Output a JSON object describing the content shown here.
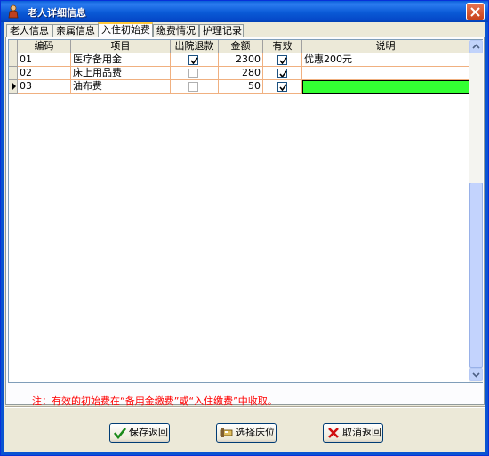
{
  "window": {
    "title": "老人详细信息"
  },
  "tabs": [
    {
      "label": "老人信息",
      "active": false
    },
    {
      "label": "亲属信息",
      "active": false
    },
    {
      "label": "入住初始费",
      "active": true
    },
    {
      "label": "缴费情况",
      "active": false
    },
    {
      "label": "护理记录",
      "active": false
    }
  ],
  "grid": {
    "columns": [
      "编码",
      "项目",
      "出院退款",
      "金额",
      "有效",
      "说明"
    ],
    "rows": [
      {
        "code": "01",
        "item": "医疗备用金",
        "refund": true,
        "amount": "2300",
        "valid": true,
        "note": "优惠200元"
      },
      {
        "code": "02",
        "item": "床上用品费",
        "refund": false,
        "amount": "280",
        "valid": true,
        "note": ""
      },
      {
        "code": "03",
        "item": "油布费",
        "refund": false,
        "amount": "50",
        "valid": true,
        "note": "",
        "current": true
      }
    ]
  },
  "note": "注：有效的初始费在“备用金缴费”或“入住缴费”中收取。",
  "buttons": {
    "save": "保存返回",
    "bed": "选择床位",
    "cancel": "取消返回"
  },
  "colors": {
    "title_bar": "#0a5ad6",
    "note_text": "#ff0000",
    "highlight_cell": "#33ff33",
    "grid_line": "#f0b080"
  }
}
